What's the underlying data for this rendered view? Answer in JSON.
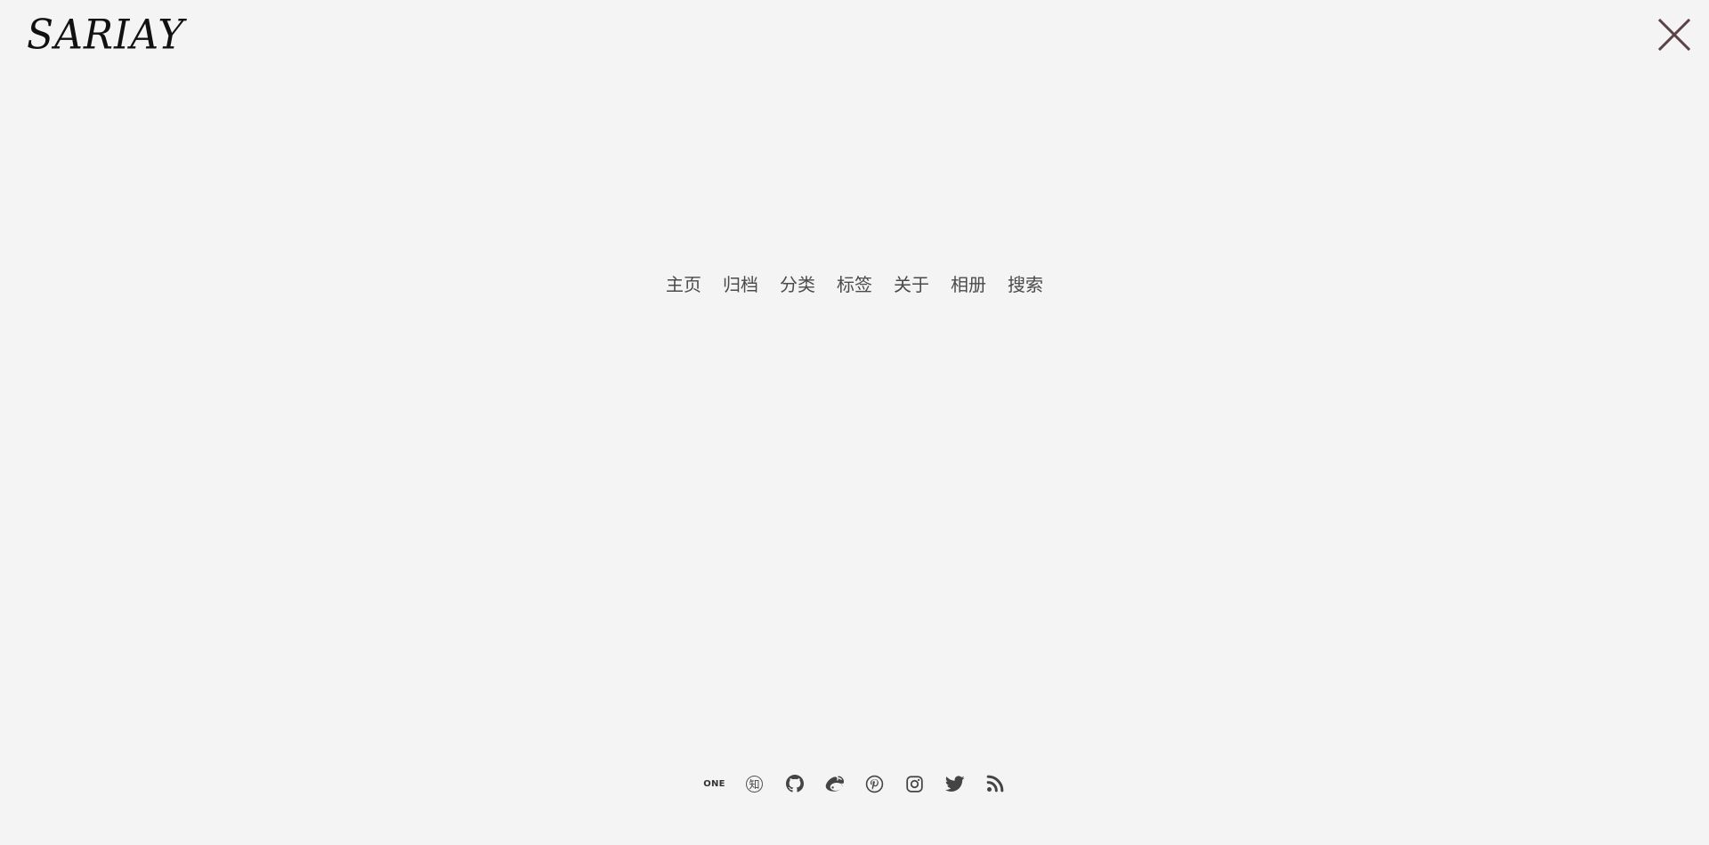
{
  "header": {
    "logo_text": "SARIAY"
  },
  "menu": {
    "items": [
      {
        "label": "主页"
      },
      {
        "label": "归档"
      },
      {
        "label": "分类"
      },
      {
        "label": "标签"
      },
      {
        "label": "关于"
      },
      {
        "label": "相册"
      },
      {
        "label": "搜索"
      }
    ]
  },
  "social": {
    "one_label": "ONE",
    "zhihu_label": "知",
    "icons": [
      "one-icon",
      "zhihu-icon",
      "github-icon",
      "weibo-icon",
      "pinterest-icon",
      "instagram-icon",
      "twitter-icon",
      "rss-icon"
    ]
  },
  "colors": {
    "background": "#f4f4f4",
    "text": "#4a4a4a",
    "close_icon": "#5a4248"
  }
}
